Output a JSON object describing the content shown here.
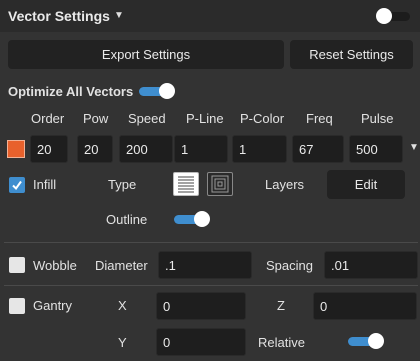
{
  "header": {
    "title": "Vector Settings",
    "enabled": false
  },
  "buttons": {
    "export": "Export Settings",
    "reset": "Reset Settings"
  },
  "optimize": {
    "label": "Optimize All Vectors",
    "enabled": true
  },
  "columns": {
    "order": "Order",
    "pow": "Pow",
    "speed": "Speed",
    "pline": "P-Line",
    "pcolor": "P-Color",
    "freq": "Freq",
    "pulse": "Pulse"
  },
  "row": {
    "color": "#e8612c",
    "order": "20",
    "pow": "20",
    "speed": "200",
    "pline": "1",
    "pcolor": "1",
    "freq": "67",
    "pulse": "500"
  },
  "infill": {
    "label": "Infill",
    "checked": true,
    "type_label": "Type",
    "layers_label": "Layers",
    "edit_label": "Edit",
    "outline_label": "Outline",
    "outline_enabled": true
  },
  "wobble": {
    "label": "Wobble",
    "checked": false,
    "diameter_label": "Diameter",
    "diameter": ".1",
    "spacing_label": "Spacing",
    "spacing": ".01"
  },
  "gantry": {
    "label": "Gantry",
    "checked": false,
    "x_label": "X",
    "x": "0",
    "z_label": "Z",
    "z": "0",
    "y_label": "Y",
    "y": "0",
    "relative_label": "Relative",
    "relative_enabled": true
  }
}
